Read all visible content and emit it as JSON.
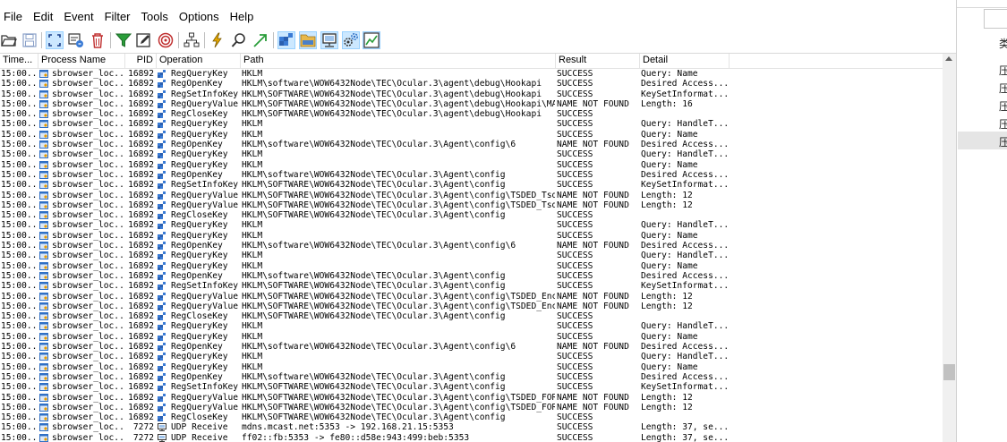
{
  "menu": [
    "File",
    "Edit",
    "Event",
    "Filter",
    "Tools",
    "Options",
    "Help"
  ],
  "toolbar": {
    "icons": [
      "open-icon",
      "save-icon",
      "autoscroll-icon",
      "clear-display-icon",
      "delete-icon",
      "filter-icon",
      "highlight-icon",
      "include-process-icon",
      "process-tree-icon",
      "event-properties-icon",
      "find-icon",
      "jump-to-icon",
      "registry-activity-icon",
      "file-activity-icon",
      "network-activity-icon",
      "process-thread-activity-icon",
      "profiling-icon"
    ]
  },
  "columns": {
    "time": "Time...",
    "process": "Process Name",
    "pid": "PID",
    "operation": "Operation",
    "path": "Path",
    "result": "Result",
    "detail": "Detail"
  },
  "rows": [
    {
      "time": "15:00...",
      "process": "sbrowser_loc...",
      "pid": "16892",
      "op": "RegQueryKey",
      "path": "HKLM",
      "result": "SUCCESS",
      "detail": "Query: Name",
      "kind": "reg"
    },
    {
      "time": "15:00...",
      "process": "sbrowser_loc...",
      "pid": "16892",
      "op": "RegOpenKey",
      "path": "HKLM\\software\\WOW6432Node\\TEC\\Ocular.3\\agent\\debug\\Hookapi",
      "result": "SUCCESS",
      "detail": "Desired Access...",
      "kind": "reg"
    },
    {
      "time": "15:00...",
      "process": "sbrowser_loc...",
      "pid": "16892",
      "op": "RegSetInfoKey",
      "path": "HKLM\\SOFTWARE\\WOW6432Node\\TEC\\Ocular.3\\agent\\debug\\Hookapi",
      "result": "SUCCESS",
      "detail": "KeySetInformat...",
      "kind": "reg"
    },
    {
      "time": "15:00...",
      "process": "sbrowser_loc...",
      "pid": "16892",
      "op": "RegQueryValue",
      "path": "HKLM\\SOFTWARE\\WOW6432Node\\TEC\\Ocular.3\\agent\\debug\\Hookapi\\MAXL...",
      "result": "NAME NOT FOUND",
      "detail": "Length: 16",
      "kind": "reg"
    },
    {
      "time": "15:00...",
      "process": "sbrowser_loc...",
      "pid": "16892",
      "op": "RegCloseKey",
      "path": "HKLM\\SOFTWARE\\WOW6432Node\\TEC\\Ocular.3\\agent\\debug\\Hookapi",
      "result": "SUCCESS",
      "detail": "",
      "kind": "reg"
    },
    {
      "time": "15:00...",
      "process": "sbrowser_loc...",
      "pid": "16892",
      "op": "RegQueryKey",
      "path": "HKLM",
      "result": "SUCCESS",
      "detail": "Query: HandleT...",
      "kind": "reg"
    },
    {
      "time": "15:00...",
      "process": "sbrowser_loc...",
      "pid": "16892",
      "op": "RegQueryKey",
      "path": "HKLM",
      "result": "SUCCESS",
      "detail": "Query: Name",
      "kind": "reg"
    },
    {
      "time": "15:00...",
      "process": "sbrowser_loc...",
      "pid": "16892",
      "op": "RegOpenKey",
      "path": "HKLM\\software\\WOW6432Node\\TEC\\Ocular.3\\Agent\\config\\6",
      "result": "NAME NOT FOUND",
      "detail": "Desired Access...",
      "kind": "reg"
    },
    {
      "time": "15:00...",
      "process": "sbrowser_loc...",
      "pid": "16892",
      "op": "RegQueryKey",
      "path": "HKLM",
      "result": "SUCCESS",
      "detail": "Query: HandleT...",
      "kind": "reg"
    },
    {
      "time": "15:00...",
      "process": "sbrowser_loc...",
      "pid": "16892",
      "op": "RegQueryKey",
      "path": "HKLM",
      "result": "SUCCESS",
      "detail": "Query: Name",
      "kind": "reg"
    },
    {
      "time": "15:00...",
      "process": "sbrowser_loc...",
      "pid": "16892",
      "op": "RegOpenKey",
      "path": "HKLM\\software\\WOW6432Node\\TEC\\Ocular.3\\Agent\\config",
      "result": "SUCCESS",
      "detail": "Desired Access...",
      "kind": "reg"
    },
    {
      "time": "15:00...",
      "process": "sbrowser_loc...",
      "pid": "16892",
      "op": "RegSetInfoKey",
      "path": "HKLM\\SOFTWARE\\WOW6432Node\\TEC\\Ocular.3\\Agent\\config",
      "result": "SUCCESS",
      "detail": "KeySetInformat...",
      "kind": "reg"
    },
    {
      "time": "15:00...",
      "process": "sbrowser_loc...",
      "pid": "16892",
      "op": "RegQueryValue",
      "path": "HKLM\\SOFTWARE\\WOW6432Node\\TEC\\Ocular.3\\Agent\\config\\TSDED_TsdSy...",
      "result": "NAME NOT FOUND",
      "detail": "Length: 12",
      "kind": "reg"
    },
    {
      "time": "15:00...",
      "process": "sbrowser_loc...",
      "pid": "16892",
      "op": "RegQueryValue",
      "path": "HKLM\\SOFTWARE\\WOW6432Node\\TEC\\Ocular.3\\Agent\\config\\TSDED_TsdSy...",
      "result": "NAME NOT FOUND",
      "detail": "Length: 12",
      "kind": "reg"
    },
    {
      "time": "15:00...",
      "process": "sbrowser_loc...",
      "pid": "16892",
      "op": "RegCloseKey",
      "path": "HKLM\\SOFTWARE\\WOW6432Node\\TEC\\Ocular.3\\Agent\\config",
      "result": "SUCCESS",
      "detail": "",
      "kind": "reg"
    },
    {
      "time": "15:00...",
      "process": "sbrowser_loc...",
      "pid": "16892",
      "op": "RegQueryKey",
      "path": "HKLM",
      "result": "SUCCESS",
      "detail": "Query: HandleT...",
      "kind": "reg"
    },
    {
      "time": "15:00...",
      "process": "sbrowser_loc...",
      "pid": "16892",
      "op": "RegQueryKey",
      "path": "HKLM",
      "result": "SUCCESS",
      "detail": "Query: Name",
      "kind": "reg"
    },
    {
      "time": "15:00...",
      "process": "sbrowser_loc...",
      "pid": "16892",
      "op": "RegOpenKey",
      "path": "HKLM\\software\\WOW6432Node\\TEC\\Ocular.3\\Agent\\config\\6",
      "result": "NAME NOT FOUND",
      "detail": "Desired Access...",
      "kind": "reg"
    },
    {
      "time": "15:00...",
      "process": "sbrowser_loc...",
      "pid": "16892",
      "op": "RegQueryKey",
      "path": "HKLM",
      "result": "SUCCESS",
      "detail": "Query: HandleT...",
      "kind": "reg"
    },
    {
      "time": "15:00...",
      "process": "sbrowser_loc...",
      "pid": "16892",
      "op": "RegQueryKey",
      "path": "HKLM",
      "result": "SUCCESS",
      "detail": "Query: Name",
      "kind": "reg"
    },
    {
      "time": "15:00...",
      "process": "sbrowser_loc...",
      "pid": "16892",
      "op": "RegOpenKey",
      "path": "HKLM\\software\\WOW6432Node\\TEC\\Ocular.3\\Agent\\config",
      "result": "SUCCESS",
      "detail": "Desired Access...",
      "kind": "reg"
    },
    {
      "time": "15:00...",
      "process": "sbrowser_loc...",
      "pid": "16892",
      "op": "RegSetInfoKey",
      "path": "HKLM\\SOFTWARE\\WOW6432Node\\TEC\\Ocular.3\\Agent\\config",
      "result": "SUCCESS",
      "detail": "KeySetInformat...",
      "kind": "reg"
    },
    {
      "time": "15:00...",
      "process": "sbrowser_loc...",
      "pid": "16892",
      "op": "RegQueryValue",
      "path": "HKLM\\SOFTWARE\\WOW6432Node\\TEC\\Ocular.3\\Agent\\config\\TSDED_Encry...",
      "result": "NAME NOT FOUND",
      "detail": "Length: 12",
      "kind": "reg"
    },
    {
      "time": "15:00...",
      "process": "sbrowser_loc...",
      "pid": "16892",
      "op": "RegQueryValue",
      "path": "HKLM\\SOFTWARE\\WOW6432Node\\TEC\\Ocular.3\\Agent\\config\\TSDED_Encry...",
      "result": "NAME NOT FOUND",
      "detail": "Length: 12",
      "kind": "reg"
    },
    {
      "time": "15:00...",
      "process": "sbrowser_loc...",
      "pid": "16892",
      "op": "RegCloseKey",
      "path": "HKLM\\SOFTWARE\\WOW6432Node\\TEC\\Ocular.3\\Agent\\config",
      "result": "SUCCESS",
      "detail": "",
      "kind": "reg"
    },
    {
      "time": "15:00...",
      "process": "sbrowser_loc...",
      "pid": "16892",
      "op": "RegQueryKey",
      "path": "HKLM",
      "result": "SUCCESS",
      "detail": "Query: HandleT...",
      "kind": "reg"
    },
    {
      "time": "15:00...",
      "process": "sbrowser_loc...",
      "pid": "16892",
      "op": "RegQueryKey",
      "path": "HKLM",
      "result": "SUCCESS",
      "detail": "Query: Name",
      "kind": "reg"
    },
    {
      "time": "15:00...",
      "process": "sbrowser_loc...",
      "pid": "16892",
      "op": "RegOpenKey",
      "path": "HKLM\\software\\WOW6432Node\\TEC\\Ocular.3\\Agent\\config\\6",
      "result": "NAME NOT FOUND",
      "detail": "Desired Access...",
      "kind": "reg"
    },
    {
      "time": "15:00...",
      "process": "sbrowser_loc...",
      "pid": "16892",
      "op": "RegQueryKey",
      "path": "HKLM",
      "result": "SUCCESS",
      "detail": "Query: HandleT...",
      "kind": "reg"
    },
    {
      "time": "15:00...",
      "process": "sbrowser_loc...",
      "pid": "16892",
      "op": "RegQueryKey",
      "path": "HKLM",
      "result": "SUCCESS",
      "detail": "Query: Name",
      "kind": "reg"
    },
    {
      "time": "15:00...",
      "process": "sbrowser_loc...",
      "pid": "16892",
      "op": "RegOpenKey",
      "path": "HKLM\\software\\WOW6432Node\\TEC\\Ocular.3\\Agent\\config",
      "result": "SUCCESS",
      "detail": "Desired Access...",
      "kind": "reg"
    },
    {
      "time": "15:00...",
      "process": "sbrowser_loc...",
      "pid": "16892",
      "op": "RegSetInfoKey",
      "path": "HKLM\\SOFTWARE\\WOW6432Node\\TEC\\Ocular.3\\Agent\\config",
      "result": "SUCCESS",
      "detail": "KeySetInformat...",
      "kind": "reg"
    },
    {
      "time": "15:00...",
      "process": "sbrowser_loc...",
      "pid": "16892",
      "op": "RegQueryValue",
      "path": "HKLM\\SOFTWARE\\WOW6432Node\\TEC\\Ocular.3\\Agent\\config\\TSDED_FORCE...",
      "result": "NAME NOT FOUND",
      "detail": "Length: 12",
      "kind": "reg"
    },
    {
      "time": "15:00...",
      "process": "sbrowser_loc...",
      "pid": "16892",
      "op": "RegQueryValue",
      "path": "HKLM\\SOFTWARE\\WOW6432Node\\TEC\\Ocular.3\\Agent\\config\\TSDED_FORCE...",
      "result": "NAME NOT FOUND",
      "detail": "Length: 12",
      "kind": "reg"
    },
    {
      "time": "15:00...",
      "process": "sbrowser_loc...",
      "pid": "16892",
      "op": "RegCloseKey",
      "path": "HKLM\\SOFTWARE\\WOW6432Node\\TEC\\Ocular.3\\Agent\\config",
      "result": "SUCCESS",
      "detail": "",
      "kind": "reg"
    },
    {
      "time": "15:00...",
      "process": "sbrowser_loc...",
      "pid": "7272",
      "op": "UDP Receive",
      "path": "mdns.mcast.net:5353 -> 192.168.21.15:5353",
      "result": "SUCCESS",
      "detail": "Length: 37, se...",
      "kind": "net"
    },
    {
      "time": "15:00...",
      "process": "sbrowser_loc...",
      "pid": "7272",
      "op": "UDP Receive",
      "path": "ff02::fb:5353 -> fe80::d58e:943:499:beb:5353",
      "result": "SUCCESS",
      "detail": "Length: 37, se...",
      "kind": "net"
    }
  ],
  "right_panel": {
    "items": [
      "类",
      "压",
      "压",
      "压",
      "压",
      "压"
    ]
  },
  "colors": {
    "accent_selected": "#cce8ff",
    "registry_icon": "#3a7bd5",
    "process_icon": "#2f6fc4"
  }
}
